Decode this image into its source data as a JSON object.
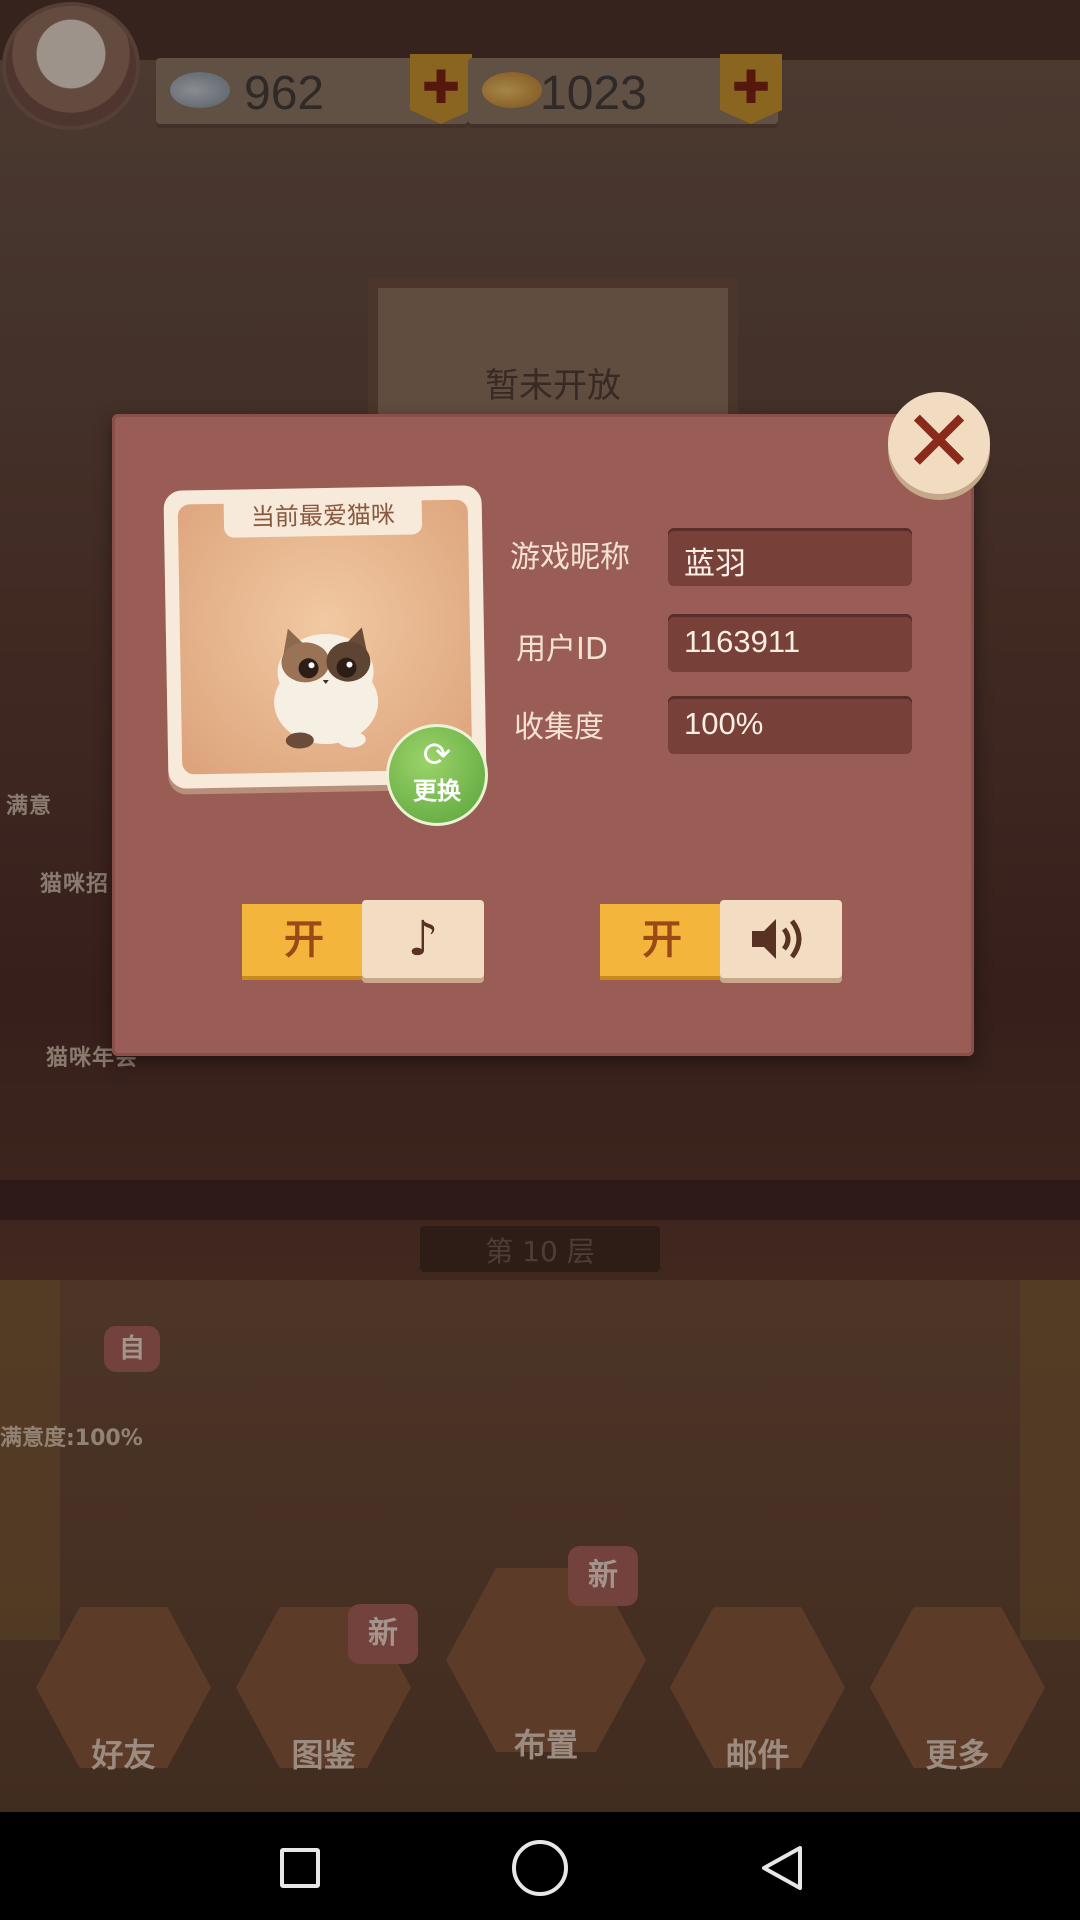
{
  "hud": {
    "silver_fish": "962",
    "gold_fish": "1023",
    "add_label": "✚"
  },
  "scene": {
    "sign_text": "暂未开放",
    "floor_text": "第 10 层",
    "left_labels": [
      "满意",
      "猫咪招",
      "猫咪年会"
    ],
    "satisfaction": "满意度:100%",
    "self_tag": "自"
  },
  "bottom_nav": [
    {
      "label": "好友",
      "icon": "friends-icon"
    },
    {
      "label": "图鉴",
      "icon": "catalog-icon",
      "badge": "新"
    },
    {
      "label": "布置",
      "icon": "decorate-icon",
      "badge": "新"
    },
    {
      "label": "邮件",
      "icon": "mail-icon"
    },
    {
      "label": "更多",
      "icon": "more-icon"
    }
  ],
  "dialog": {
    "card_title": "当前最爱猫咪",
    "swap_label": "更换",
    "fields": [
      {
        "label": "游戏昵称",
        "value": "蓝羽"
      },
      {
        "label": "用户ID",
        "value": "1163911"
      },
      {
        "label": "收集度",
        "value": "100%"
      }
    ],
    "music_toggle": {
      "state": "开",
      "icon": "music-note-icon"
    },
    "sound_toggle": {
      "state": "开",
      "icon": "speaker-icon"
    },
    "close_icon": "close-icon"
  },
  "system_nav": [
    "recent-apps-icon",
    "home-icon",
    "back-icon"
  ]
}
